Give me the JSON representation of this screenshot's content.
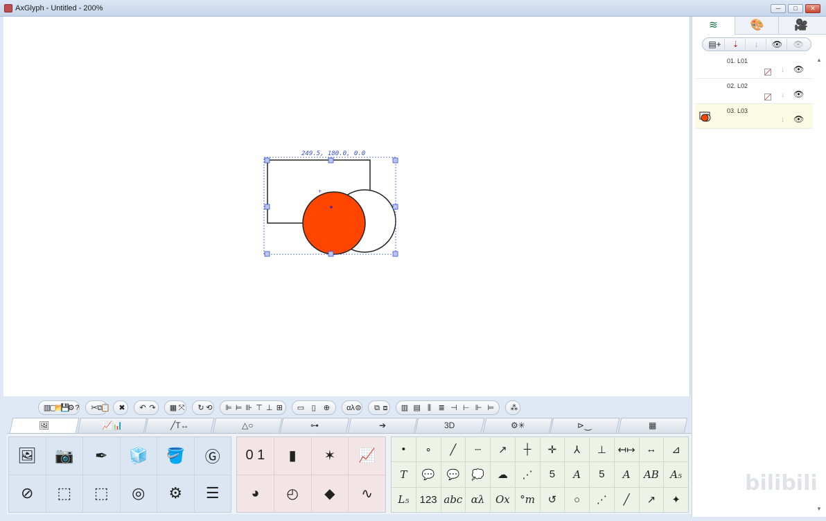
{
  "window": {
    "title": "AxGlyph - Untitled - 200%",
    "min": "─",
    "max": "□",
    "close": "✕"
  },
  "canvas": {
    "coord_readout": "249.5, 180.0, 0.0",
    "colors": {
      "circle_fill": "#ff4500",
      "selection": "#3a4fd0",
      "handle_fill": "#b9c7ef"
    }
  },
  "panel": {
    "tabs": [
      {
        "icon": "layers-icon",
        "glyph": "≋"
      },
      {
        "icon": "palette-icon",
        "glyph": "🎨"
      },
      {
        "icon": "camera-icon",
        "glyph": "🎥"
      }
    ],
    "layer_tools": [
      "▤+",
      "⇣",
      "↓",
      "👁",
      "👁"
    ],
    "layers": [
      {
        "name": "01. L01",
        "active": false
      },
      {
        "name": "02. L02",
        "active": false
      },
      {
        "name": "03. L03",
        "active": true
      }
    ],
    "eye": "👁",
    "down": "↓"
  },
  "toolbar": {
    "groups": [
      [
        "▥",
        "▢",
        "📂",
        "💾",
        "⚙",
        "?"
      ],
      [
        "✂",
        "⧉",
        "📋"
      ],
      [
        "✖"
      ],
      [
        "↶",
        "↷"
      ],
      [
        "▦",
        "⤧"
      ],
      [
        "↻",
        "⟲"
      ],
      [
        "⊫",
        "⊨",
        "⊪",
        "⊤",
        "⊥",
        "⊞"
      ],
      [
        "▭",
        "▯",
        "⊕"
      ],
      [
        "αλ",
        "⊜"
      ],
      [
        "⧉",
        "⧈"
      ],
      [
        "▥",
        "▤",
        "⫼",
        "≣",
        "⊣",
        "⊢",
        "⊩",
        "⊨"
      ],
      [
        "⁂"
      ]
    ]
  },
  "categories": [
    "🖼",
    "📈📊",
    "╱T↔",
    "△○",
    "⊶",
    "➔",
    "3D",
    "⚙✳",
    "⊳⏝",
    "▦"
  ],
  "tools": {
    "a": [
      "🖼",
      "📷",
      "✒",
      "🧊",
      "🪣",
      "Ⓖ",
      "⊘",
      "⬚",
      "⬚",
      "◎",
      "⚙",
      "☰"
    ],
    "b": [
      "0 1",
      "▮",
      "✶",
      "📈",
      "◕",
      "◴",
      "◆",
      "∿"
    ],
    "c": [
      "•",
      "∘",
      "╱",
      "┄",
      "↗",
      "┼",
      "✛",
      "⅄",
      "⊥",
      "↤↦",
      "↔",
      "⊿",
      "T",
      "💬",
      "💬",
      "💭",
      "☁",
      "⋰",
      "5",
      "A",
      "5",
      "A",
      "AB",
      "A₅",
      "L₅",
      "123",
      "abc",
      "αλ",
      "Ox",
      "°m",
      "↺",
      "○",
      "⋰",
      "╱",
      "↗",
      "✦"
    ]
  },
  "watermark": "bilibili"
}
